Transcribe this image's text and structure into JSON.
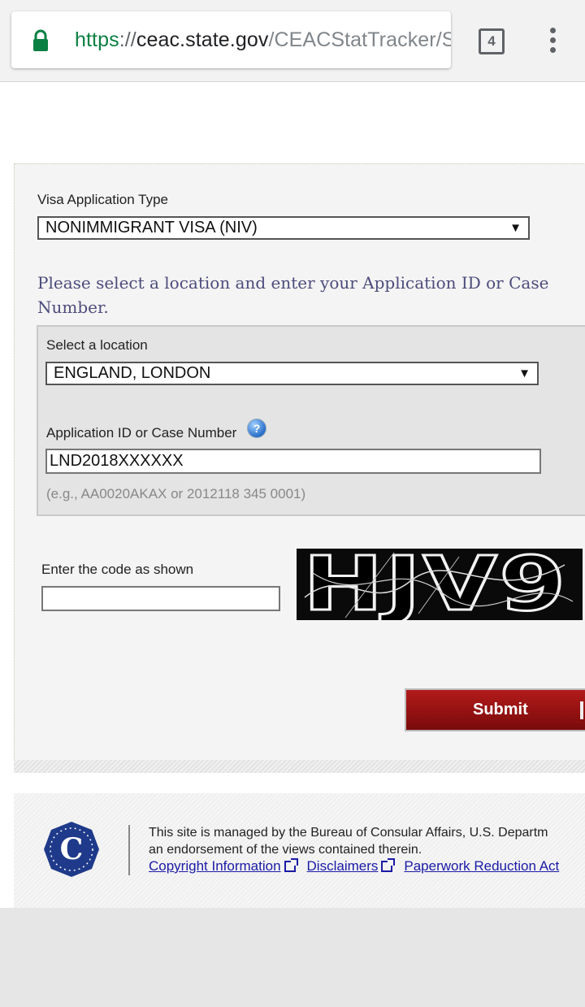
{
  "browser": {
    "url_scheme": "https",
    "url_separator": "://",
    "url_host": "ceac.state.gov",
    "url_path": "/CEACStatTracker/S",
    "tab_count": "4",
    "lock_color": "#0b8043"
  },
  "form": {
    "visa_type_label": "Visa Application Type",
    "visa_type_value": "NONIMMIGRANT VISA (NIV)",
    "prompt": "Please select a location and enter your Application ID or Case Number.",
    "location_label": "Select a location",
    "location_value": "ENGLAND, LONDON",
    "application_id_label": "Application ID or Case Number",
    "application_id_value": "LND2018XXXXXX",
    "example_hint": "(e.g., AA0020AKAX or 2012118 345 0001)",
    "captcha_label": "Enter the code as shown",
    "captcha_value": "",
    "captcha_code": "HJV9",
    "submit_label": "Submit",
    "submit_color": "#9e1212"
  },
  "footer": {
    "text_line1": "This site is managed by the Bureau of Consular Affairs, U.S. Departm",
    "text_line2": "an endorsement of the views contained therein.",
    "links": [
      "Copyright Information",
      "Disclaimers",
      "Paperwork Reduction Act"
    ],
    "seal_letter": "C"
  }
}
